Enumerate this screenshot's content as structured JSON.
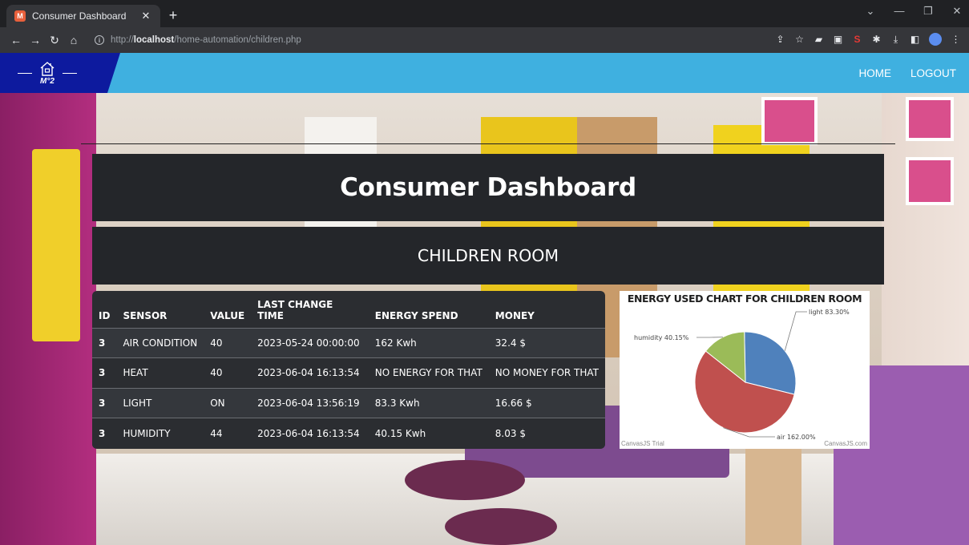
{
  "browser": {
    "tab_title": "Consumer Dashboard",
    "url_prefix": "http://",
    "url_host": "localhost",
    "url_path": "/home-automation/children.php"
  },
  "navbar": {
    "logo_text": "M°2",
    "links": [
      "HOME",
      "LOGOUT"
    ],
    "color": "#3fb0e0",
    "logo_color": "#0d1a9e"
  },
  "main": {
    "title": "Consumer Dashboard",
    "room": "CHILDREN ROOM"
  },
  "table": {
    "headers": [
      "ID",
      "SENSOR",
      "VALUE",
      "LAST CHANGE TIME",
      "ENERGY SPEND",
      "MONEY"
    ],
    "rows": [
      [
        "3",
        "AIR CONDITION",
        "40",
        "2023-05-24 00:00:00",
        "162 Kwh",
        "32.4 $"
      ],
      [
        "3",
        "HEAT",
        "40",
        "2023-06-04 16:13:54",
        "NO ENERGY FOR THAT",
        "NO MONEY FOR THAT"
      ],
      [
        "3",
        "LIGHT",
        "ON",
        "2023-06-04 13:56:19",
        "83.3 Kwh",
        "16.66 $"
      ],
      [
        "3",
        "HUMIDITY",
        "44",
        "2023-06-04 16:13:54",
        "40.15 Kwh",
        "8.03 $"
      ]
    ]
  },
  "chart_data": {
    "type": "pie",
    "title": "ENERGY USED CHART FOR CHILDREN ROOM",
    "slices": [
      {
        "label": "light 83.30%",
        "value": 83.3,
        "color": "#4f81bc"
      },
      {
        "label": "air 162.00%",
        "value": 162.0,
        "color": "#c0504e"
      },
      {
        "label": "humidity 40.15%",
        "value": 40.15,
        "color": "#9bbb58"
      }
    ],
    "credit_left": "CanvasJS Trial",
    "credit_right": "CanvasJS.com"
  }
}
